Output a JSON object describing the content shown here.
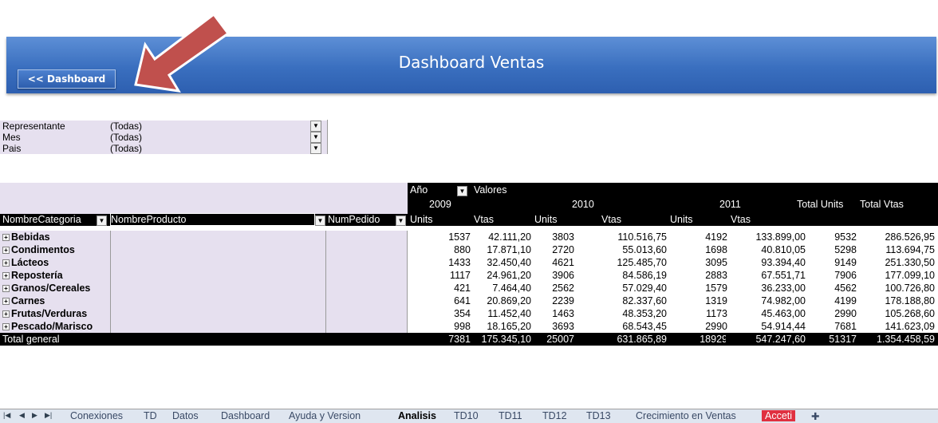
{
  "banner": {
    "title": "Dashboard Ventas",
    "back_button": "<< Dashboard"
  },
  "filters": [
    {
      "label": "Representante",
      "value": "(Todas)"
    },
    {
      "label": "Mes",
      "value": "(Todas)"
    },
    {
      "label": "Pais",
      "value": "(Todas)"
    }
  ],
  "pivot": {
    "col_field": "Año",
    "values_label": "Valores",
    "years": [
      "2009",
      "2010",
      "2011"
    ],
    "total_units_label": "Total Units",
    "total_vtas_label": "Total Vtas",
    "measure_units": "Units",
    "measure_vtas": "Vtas",
    "row_fields": [
      "NombreCategoria",
      "NombreProducto",
      "NumPedido"
    ],
    "rows": [
      {
        "name": "Bebidas",
        "u2009": "1537",
        "v2009": "42.111,20",
        "u2010": "3803",
        "v2010": "110.516,75",
        "u2011": "4192",
        "v2011": "133.899,00",
        "tu": "9532",
        "tv": "286.526,95"
      },
      {
        "name": "Condimentos",
        "u2009": "880",
        "v2009": "17.871,10",
        "u2010": "2720",
        "v2010": "55.013,60",
        "u2011": "1698",
        "v2011": "40.810,05",
        "tu": "5298",
        "tv": "113.694,75"
      },
      {
        "name": "Lácteos",
        "u2009": "1433",
        "v2009": "32.450,40",
        "u2010": "4621",
        "v2010": "125.485,70",
        "u2011": "3095",
        "v2011": "93.394,40",
        "tu": "9149",
        "tv": "251.330,50"
      },
      {
        "name": "Repostería",
        "u2009": "1117",
        "v2009": "24.961,20",
        "u2010": "3906",
        "v2010": "84.586,19",
        "u2011": "2883",
        "v2011": "67.551,71",
        "tu": "7906",
        "tv": "177.099,10"
      },
      {
        "name": "Granos/Cereales",
        "u2009": "421",
        "v2009": "7.464,40",
        "u2010": "2562",
        "v2010": "57.029,40",
        "u2011": "1579",
        "v2011": "36.233,00",
        "tu": "4562",
        "tv": "100.726,80"
      },
      {
        "name": "Carnes",
        "u2009": "641",
        "v2009": "20.869,20",
        "u2010": "2239",
        "v2010": "82.337,60",
        "u2011": "1319",
        "v2011": "74.982,00",
        "tu": "4199",
        "tv": "178.188,80"
      },
      {
        "name": "Frutas/Verduras",
        "u2009": "354",
        "v2009": "11.452,40",
        "u2010": "1463",
        "v2010": "48.353,20",
        "u2011": "1173",
        "v2011": "45.463,00",
        "tu": "2990",
        "tv": "105.268,60"
      },
      {
        "name": "Pescado/Marisco",
        "u2009": "998",
        "v2009": "18.165,20",
        "u2010": "3693",
        "v2010": "68.543,45",
        "u2011": "2990",
        "v2011": "54.914,44",
        "tu": "7681",
        "tv": "141.623,09"
      }
    ],
    "total": {
      "label": "Total general",
      "u2009": "7381",
      "v2009": "175.345,10",
      "u2010": "25007",
      "v2010": "631.865,89",
      "u2011": "18929",
      "v2011": "547.247,60",
      "tu": "51317",
      "tv": "1.354.458,59"
    }
  },
  "sheet_tabs": [
    {
      "label": "Conexiones"
    },
    {
      "label": "TD"
    },
    {
      "label": "Datos"
    },
    {
      "label": "Dashboard"
    },
    {
      "label": "Ayuda y Version"
    },
    {
      "label": "Analisis"
    },
    {
      "label": "TD10"
    },
    {
      "label": "TD11"
    },
    {
      "label": "TD12"
    },
    {
      "label": "TD13"
    },
    {
      "label": "Crecimiento en Ventas"
    },
    {
      "label": "Acceti"
    }
  ],
  "colors": {
    "banner": "#3a6fbf",
    "arrow": "#c0504d",
    "filter_bg": "#e6e0ef",
    "header_black": "#000000",
    "accent_tab": "#e03040"
  }
}
